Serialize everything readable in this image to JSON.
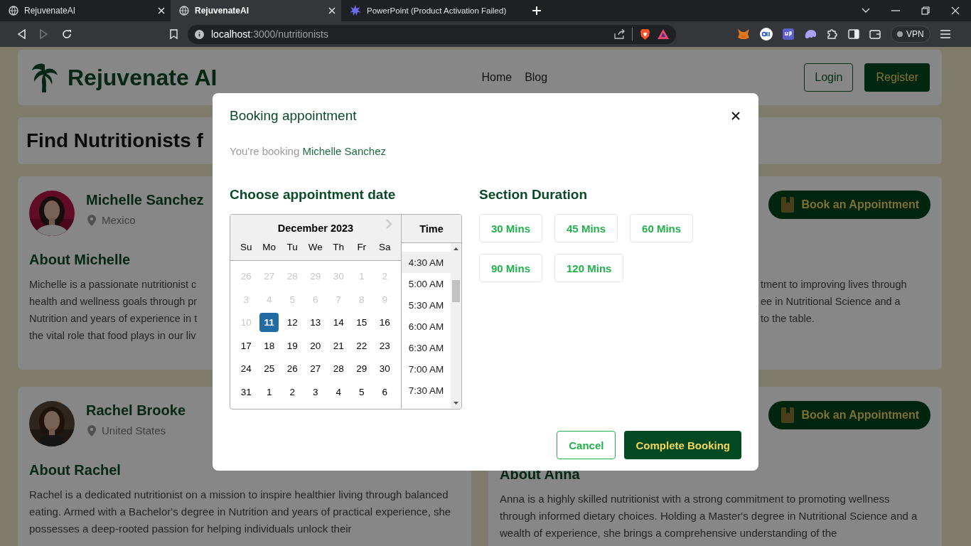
{
  "browser": {
    "tabs": [
      {
        "kind": "globe",
        "title": "RejuvenateAI",
        "selected": false
      },
      {
        "kind": "globe",
        "title": "RejuvenateAI",
        "selected": true
      },
      {
        "kind": "spark",
        "title": "PowerPoint (Product Activation Failed)",
        "selected": false
      }
    ],
    "address": {
      "host": "localhost",
      "path": ":3000/nutritionists"
    },
    "vpn": "VPN"
  },
  "header": {
    "brand": "Rejuvenate AI",
    "nav": [
      "Home",
      "Blog"
    ],
    "login": "Login",
    "register": "Register"
  },
  "page_title": "Find Nutritionists f",
  "featured": {
    "name": "Michelle Sanchez",
    "location": "Mexico",
    "button": "Book an Appointment",
    "about": "About Michelle",
    "lines_left": [
      "Michelle is a passionate nutritionist c",
      "health and wellness goals through pr",
      "Nutrition and years of experience in t",
      "the vital role that food plays in our liv"
    ],
    "lines_right": [
      "tment to improving lives through",
      "ee in Nutritional Science and a",
      "to the table."
    ]
  },
  "cards": [
    {
      "name": "Rachel Brooke",
      "location": "United States",
      "about": "About Rachel",
      "bio": "Rachel is a dedicated nutritionist on a mission to inspire healthier living through balanced eating. Armed with a Bachelor's degree in Nutrition and years of practical experience, she possesses a deep-rooted passion for helping individuals unlock their"
    },
    {
      "button": "Book an Appointment",
      "about": "About Anna",
      "bio": "Anna is a highly skilled nutritionist with a strong commitment to promoting wellness through informed dietary choices. Holding a Master's degree in Nutritional Science and a wealth of experience, she brings a comprehensive understanding of the"
    }
  ],
  "modal": {
    "title": "Booking appointment",
    "booking": {
      "prefix": "You're booking",
      "name": "Michelle Sanchez"
    },
    "date_heading": "Choose appointment date",
    "calendar": {
      "month": "December 2023",
      "weekdays": [
        "Su",
        "Mo",
        "Tu",
        "We",
        "Th",
        "Fr",
        "Sa"
      ],
      "weeks": [
        [
          {
            "day": "26",
            "disabled": true,
            "selected": false
          },
          {
            "day": "27",
            "disabled": true,
            "selected": false
          },
          {
            "day": "28",
            "disabled": true,
            "selected": false
          },
          {
            "day": "29",
            "disabled": true,
            "selected": false
          },
          {
            "day": "30",
            "disabled": true,
            "selected": false
          },
          {
            "day": "1",
            "disabled": true,
            "selected": false
          },
          {
            "day": "2",
            "disabled": true,
            "selected": false
          }
        ],
        [
          {
            "day": "3",
            "disabled": true,
            "selected": false
          },
          {
            "day": "4",
            "disabled": true,
            "selected": false
          },
          {
            "day": "5",
            "disabled": true,
            "selected": false
          },
          {
            "day": "6",
            "disabled": true,
            "selected": false
          },
          {
            "day": "7",
            "disabled": true,
            "selected": false
          },
          {
            "day": "8",
            "disabled": true,
            "selected": false
          },
          {
            "day": "9",
            "disabled": true,
            "selected": false
          }
        ],
        [
          {
            "day": "10",
            "disabled": true,
            "selected": false
          },
          {
            "day": "11",
            "disabled": false,
            "selected": true
          },
          {
            "day": "12",
            "disabled": false,
            "selected": false
          },
          {
            "day": "13",
            "disabled": false,
            "selected": false
          },
          {
            "day": "14",
            "disabled": false,
            "selected": false
          },
          {
            "day": "15",
            "disabled": false,
            "selected": false
          },
          {
            "day": "16",
            "disabled": false,
            "selected": false
          }
        ],
        [
          {
            "day": "17",
            "disabled": false,
            "selected": false
          },
          {
            "day": "18",
            "disabled": false,
            "selected": false
          },
          {
            "day": "19",
            "disabled": false,
            "selected": false
          },
          {
            "day": "20",
            "disabled": false,
            "selected": false
          },
          {
            "day": "21",
            "disabled": false,
            "selected": false
          },
          {
            "day": "22",
            "disabled": false,
            "selected": false
          },
          {
            "day": "23",
            "disabled": false,
            "selected": false
          }
        ],
        [
          {
            "day": "24",
            "disabled": false,
            "selected": false
          },
          {
            "day": "25",
            "disabled": false,
            "selected": false
          },
          {
            "day": "26",
            "disabled": false,
            "selected": false
          },
          {
            "day": "27",
            "disabled": false,
            "selected": false
          },
          {
            "day": "28",
            "disabled": false,
            "selected": false
          },
          {
            "day": "29",
            "disabled": false,
            "selected": false
          },
          {
            "day": "30",
            "disabled": false,
            "selected": false
          }
        ],
        [
          {
            "day": "31",
            "disabled": false,
            "selected": false
          },
          {
            "day": "1",
            "disabled": false,
            "selected": false
          },
          {
            "day": "2",
            "disabled": false,
            "selected": false
          },
          {
            "day": "3",
            "disabled": false,
            "selected": false
          },
          {
            "day": "4",
            "disabled": false,
            "selected": false
          },
          {
            "day": "5",
            "disabled": false,
            "selected": false
          },
          {
            "day": "6",
            "disabled": false,
            "selected": false
          }
        ]
      ]
    },
    "time": {
      "header": "Time",
      "slots": [
        {
          "label": "4:30 AM",
          "selected": true
        },
        {
          "label": "5:00 AM",
          "selected": false
        },
        {
          "label": "5:30 AM",
          "selected": false
        },
        {
          "label": "6:00 AM",
          "selected": false
        },
        {
          "label": "6:30 AM",
          "selected": false
        },
        {
          "label": "7:00 AM",
          "selected": false
        },
        {
          "label": "7:30 AM",
          "selected": false
        }
      ]
    },
    "duration_heading": "Section Duration",
    "durations": [
      {
        "label": "30 Mins",
        "selected": false
      },
      {
        "label": "45 Mins",
        "selected": false
      },
      {
        "label": "60 Mins",
        "selected": false
      },
      {
        "label": "90 Mins",
        "selected": false
      },
      {
        "label": "120 Mins",
        "selected": false
      }
    ],
    "cancel": "Cancel",
    "confirm": "Complete Booking"
  }
}
